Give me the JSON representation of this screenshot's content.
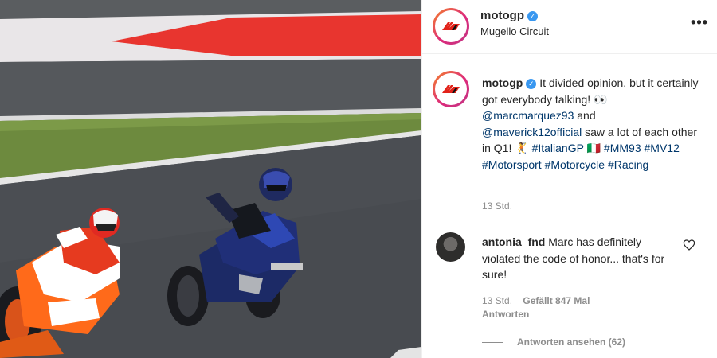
{
  "header": {
    "username": "motogp",
    "location": "Mugello Circuit",
    "more_label": "•••"
  },
  "post": {
    "author": "motogp",
    "caption_text": "It divided opinion, but it certainly got everybody talking! 👀",
    "mention_1": "@marcmarquez93",
    "connector": "and",
    "mention_2": "@maverick12official",
    "caption_text_2": "saw a lot of each other in Q1! 🤾",
    "tag_italiangp": "#ItalianGP",
    "flag": "🇮🇹",
    "tag_mm93": "#MM93",
    "tag_mv12": "#MV12",
    "tag_motorsport": "#Motorsport",
    "tag_motorcycle": "#Motorcycle",
    "tag_racing": "#Racing",
    "time": "13 Std."
  },
  "comment": {
    "username": "antonia_fnd",
    "text": "Marc has definitely violated the code of honor... that's for sure!",
    "time": "13 Std.",
    "likes": "Gefällt 847 Mal",
    "reply": "Antworten",
    "view_replies": "Antworten ansehen (62)"
  },
  "colors": {
    "link": "#00376b",
    "verified": "#3897f0",
    "muted": "#8e8e8e",
    "text": "#262626"
  },
  "icons": {
    "verified": "verified-badge-icon",
    "more": "more-options-icon",
    "heart": "heart-outline-icon"
  }
}
